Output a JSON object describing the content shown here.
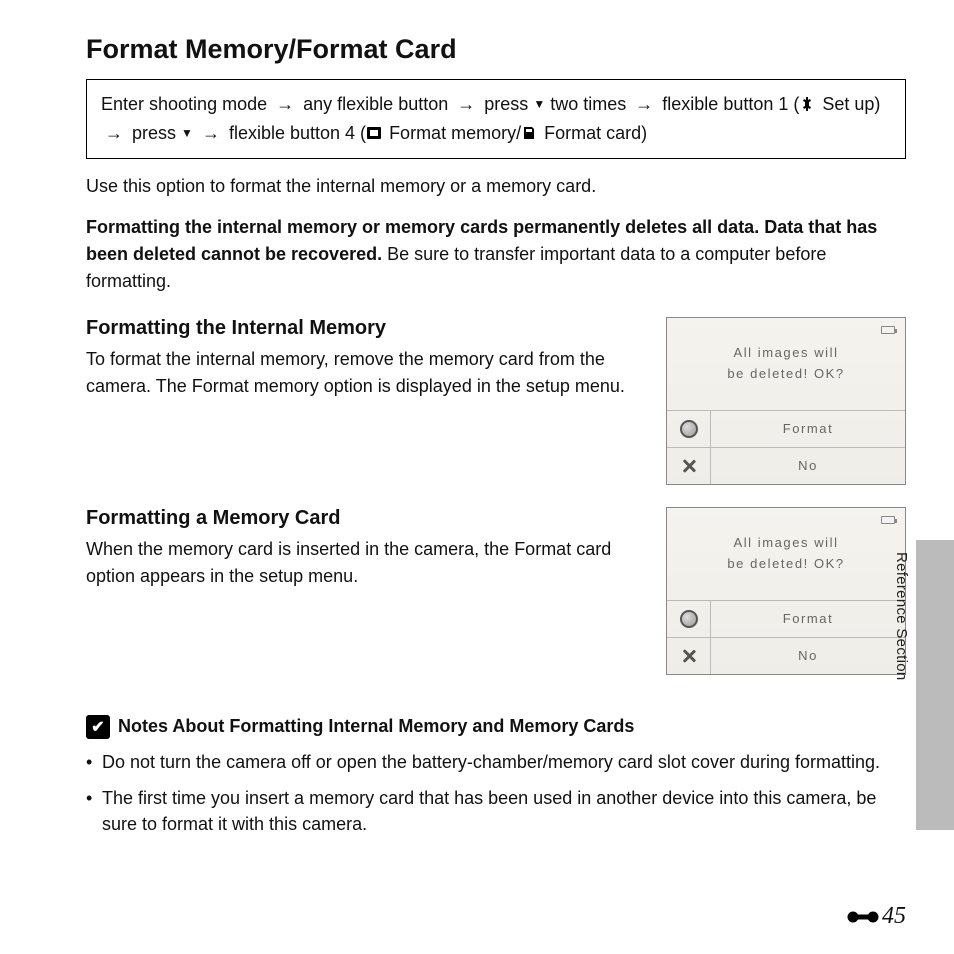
{
  "title": "Format Memory/Format Card",
  "nav": {
    "segments": [
      "Enter shooting mode",
      "any flexible button",
      "press",
      "two times",
      "flexible button 1 (",
      " Set up)",
      "press",
      "flexible button 4 (",
      " Format memory/",
      " Format card)"
    ]
  },
  "intro": "Use this option to format the internal memory or a memory card.",
  "warning_bold": "Formatting the internal memory or memory cards permanently deletes all data. Data that has been deleted cannot be recovered.",
  "warning_tail": " Be sure to transfer important data to a computer before formatting.",
  "section1": {
    "heading": "Formatting the Internal Memory",
    "text_pre": "To format the internal memory, remove the memory card from the camera. The ",
    "text_bold": "Format memory",
    "text_post": " option is displayed in the setup menu."
  },
  "section2": {
    "heading": "Formatting a Memory Card",
    "text_pre": "When the memory card is inserted in the camera, the ",
    "text_bold": "Format card",
    "text_post": " option appears in the setup menu."
  },
  "screen": {
    "line1": "All images will",
    "line2": "be deleted! OK?",
    "opt_format": "Format",
    "opt_no": "No"
  },
  "notes": {
    "heading": "Notes About Formatting Internal Memory and Memory Cards",
    "items": [
      "Do not turn the camera off or open the battery-chamber/memory card slot cover during formatting.",
      "The first time you insert a memory card that has been used in another device into this camera, be sure to format it with this camera."
    ]
  },
  "side_label": "Reference Section",
  "page_number": "45"
}
